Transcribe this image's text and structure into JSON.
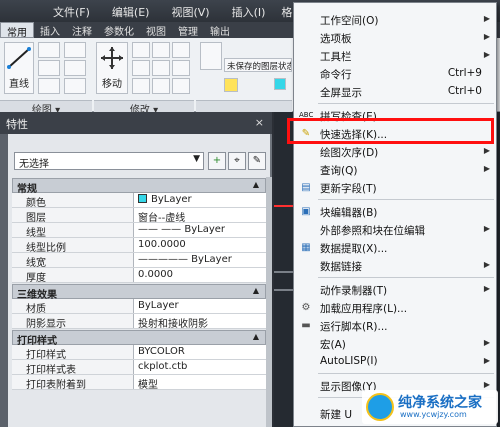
{
  "menubar": [
    "文件(F)",
    "编辑(E)",
    "视图(V)",
    "插入(I)",
    "格式(O)"
  ],
  "ribbon_tabs": [
    "常用",
    "插入",
    "注释",
    "参数化",
    "视图",
    "管理",
    "输出"
  ],
  "ribbon": {
    "line_label": "直线",
    "move_label": "移动",
    "draw_panel": "绘图",
    "modify_panel": "修改",
    "layer_state": "未保存的图层状态"
  },
  "properties": {
    "title": "特性",
    "close": "×",
    "selection": "无选择",
    "sections": [
      {
        "name": "常规",
        "rows": [
          {
            "key": "颜色",
            "value": "ByLayer",
            "swatch": true
          },
          {
            "key": "图层",
            "value": "窗台--虚线"
          },
          {
            "key": "线型",
            "value": "—— —— ByLayer"
          },
          {
            "key": "线型比例",
            "value": "100.0000"
          },
          {
            "key": "线宽",
            "value": "—————  ByLayer"
          },
          {
            "key": "厚度",
            "value": "0.0000"
          }
        ]
      },
      {
        "name": "三维效果",
        "rows": [
          {
            "key": "材质",
            "value": "ByLayer"
          },
          {
            "key": "阴影显示",
            "value": "投射和接收阴影"
          }
        ]
      },
      {
        "name": "打印样式",
        "rows": [
          {
            "key": "打印样式",
            "value": "BYCOLOR"
          },
          {
            "key": "打印样式表",
            "value": "ckplot.ctb"
          },
          {
            "key": "打印表附着到",
            "value": "模型"
          }
        ]
      }
    ]
  },
  "context_menu": {
    "items": [
      {
        "label": "工作空间(O)",
        "submenu": true,
        "icon": ""
      },
      {
        "label": "选项板",
        "submenu": true,
        "icon": ""
      },
      {
        "label": "工具栏",
        "submenu": true,
        "icon": ""
      },
      {
        "label": "命令行",
        "shortcut": "Ctrl+9",
        "icon": ""
      },
      {
        "label": "全屏显示",
        "shortcut": "Ctrl+0",
        "icon": ""
      },
      {
        "label": "拼写检查(E)",
        "icon": "spell-check-icon"
      },
      {
        "label": "快速选择(K)...",
        "icon": "quick-select-icon"
      },
      {
        "label": "绘图次序(D)",
        "submenu": true,
        "icon": ""
      },
      {
        "label": "查询(Q)",
        "submenu": true,
        "icon": ""
      },
      {
        "label": "更新字段(T)",
        "icon": "update-field-icon"
      },
      {
        "label": "块编辑器(B)",
        "icon": "block-editor-icon"
      },
      {
        "label": "外部参照和块在位编辑",
        "submenu": true,
        "icon": ""
      },
      {
        "label": "数据提取(X)...",
        "icon": "data-extraction-icon"
      },
      {
        "label": "数据链接",
        "submenu": true,
        "icon": ""
      },
      {
        "label": "动作录制器(T)",
        "submenu": true,
        "icon": ""
      },
      {
        "label": "加载应用程序(L)...",
        "icon": "load-app-icon"
      },
      {
        "label": "运行脚本(R)...",
        "icon": "run-script-icon"
      },
      {
        "label": "宏(A)",
        "submenu": true,
        "icon": ""
      },
      {
        "label": "AutoLISP(I)",
        "submenu": true,
        "icon": ""
      },
      {
        "label": "显示图像(Y)",
        "submenu": true,
        "icon": ""
      },
      {
        "label": "新建 U",
        "icon": ""
      }
    ]
  },
  "watermark": {
    "text": "纯净系统之家",
    "url": "www.ycwjzy.com"
  },
  "colors": {
    "highlight": "#ff1010",
    "color_swatch": "#35d7e8",
    "watermark_blue": "#1a6fc4"
  }
}
